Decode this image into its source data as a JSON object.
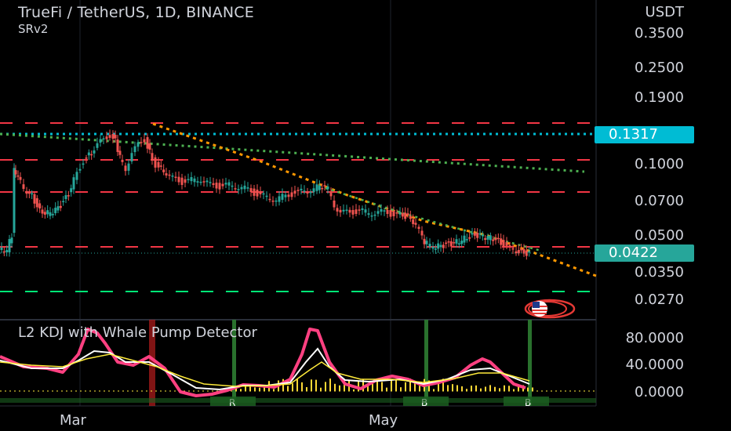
{
  "header": {
    "title": "TrueFi / TetherUS, 1D, BINANCE",
    "indicator": "SRv2"
  },
  "price_axis": {
    "unit": "USDT",
    "labels": [
      "0.3500",
      "0.2500",
      "0.1900",
      "0.1000",
      "0.0700",
      "0.0500",
      "0.0350",
      "0.0270"
    ],
    "tag_upper": "0.1317",
    "tag_current": "0.0422",
    "tag_upper_color": "#00bcd4",
    "tag_current_color": "#26a69a"
  },
  "oscillator": {
    "title": "L2 KDJ with Whale Pump Detector",
    "labels": [
      "80.0000",
      "40.0000",
      "0.0000"
    ],
    "signal_label": "B"
  },
  "time_axis": {
    "labels": [
      "Mar",
      "May"
    ]
  },
  "colors": {
    "up": "#26a69a",
    "down": "#ef5350",
    "resistance": "#f23645",
    "support": "#00e676",
    "trend_upper": "#00bcd4",
    "trend_green": "#4caf50",
    "trend_orange": "#ff9800",
    "kdj_j": "#ff4081",
    "kdj_k": "#ffffff",
    "kdj_d": "#ffeb3b"
  }
}
